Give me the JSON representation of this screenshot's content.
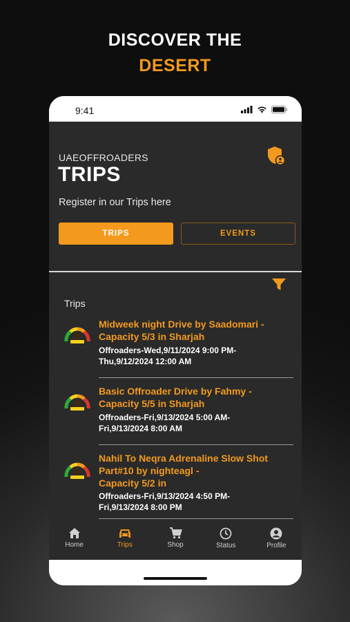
{
  "promo": {
    "line1": "DISCOVER THE",
    "line2": "DESERT"
  },
  "status_bar": {
    "time": "9:41"
  },
  "header": {
    "org": "UAEOFFROADERS",
    "title": "TRIPS",
    "subtitle": "Register in our Trips here"
  },
  "tabs": [
    {
      "label": "TRIPS",
      "active": true
    },
    {
      "label": "EVENTS",
      "active": false
    }
  ],
  "list": {
    "heading": "Trips",
    "items": [
      {
        "name": [
          "Midweek night Drive by Saadomari -",
          "Capacity 5/3 in Sharjah"
        ],
        "meta": [
          "Offroaders-Wed,9/11/2024 9:00 PM-",
          "Thu,9/12/2024 12:00 AM"
        ]
      },
      {
        "name": [
          "Basic Offroader Drive by Fahmy -",
          "Capacity 5/5 in Sharjah"
        ],
        "meta": [
          "Offroaders-Fri,9/13/2024 5:00 AM-",
          "Fri,9/13/2024 8:00 AM"
        ]
      },
      {
        "name": [
          "Nahil To Neqra Adrenaline Slow Shot",
          "Part#10 by nighteagl -",
          "Capacity 5/2 in"
        ],
        "meta": [
          "Offroaders-Fri,9/13/2024 4:50 PM-",
          "Fri,9/13/2024 8:00 PM"
        ]
      }
    ]
  },
  "nav": [
    {
      "label": "Home",
      "icon": "home-icon",
      "active": false
    },
    {
      "label": "Trips",
      "icon": "car-icon",
      "active": true
    },
    {
      "label": "Shop",
      "icon": "cart-icon",
      "active": false
    },
    {
      "label": "Status",
      "icon": "clock-icon",
      "active": false
    },
    {
      "label": "Profile",
      "icon": "user-icon",
      "active": false
    }
  ],
  "colors": {
    "accent": "#f39a1e",
    "background": "#2a2a2a",
    "text": "#ffffff"
  }
}
